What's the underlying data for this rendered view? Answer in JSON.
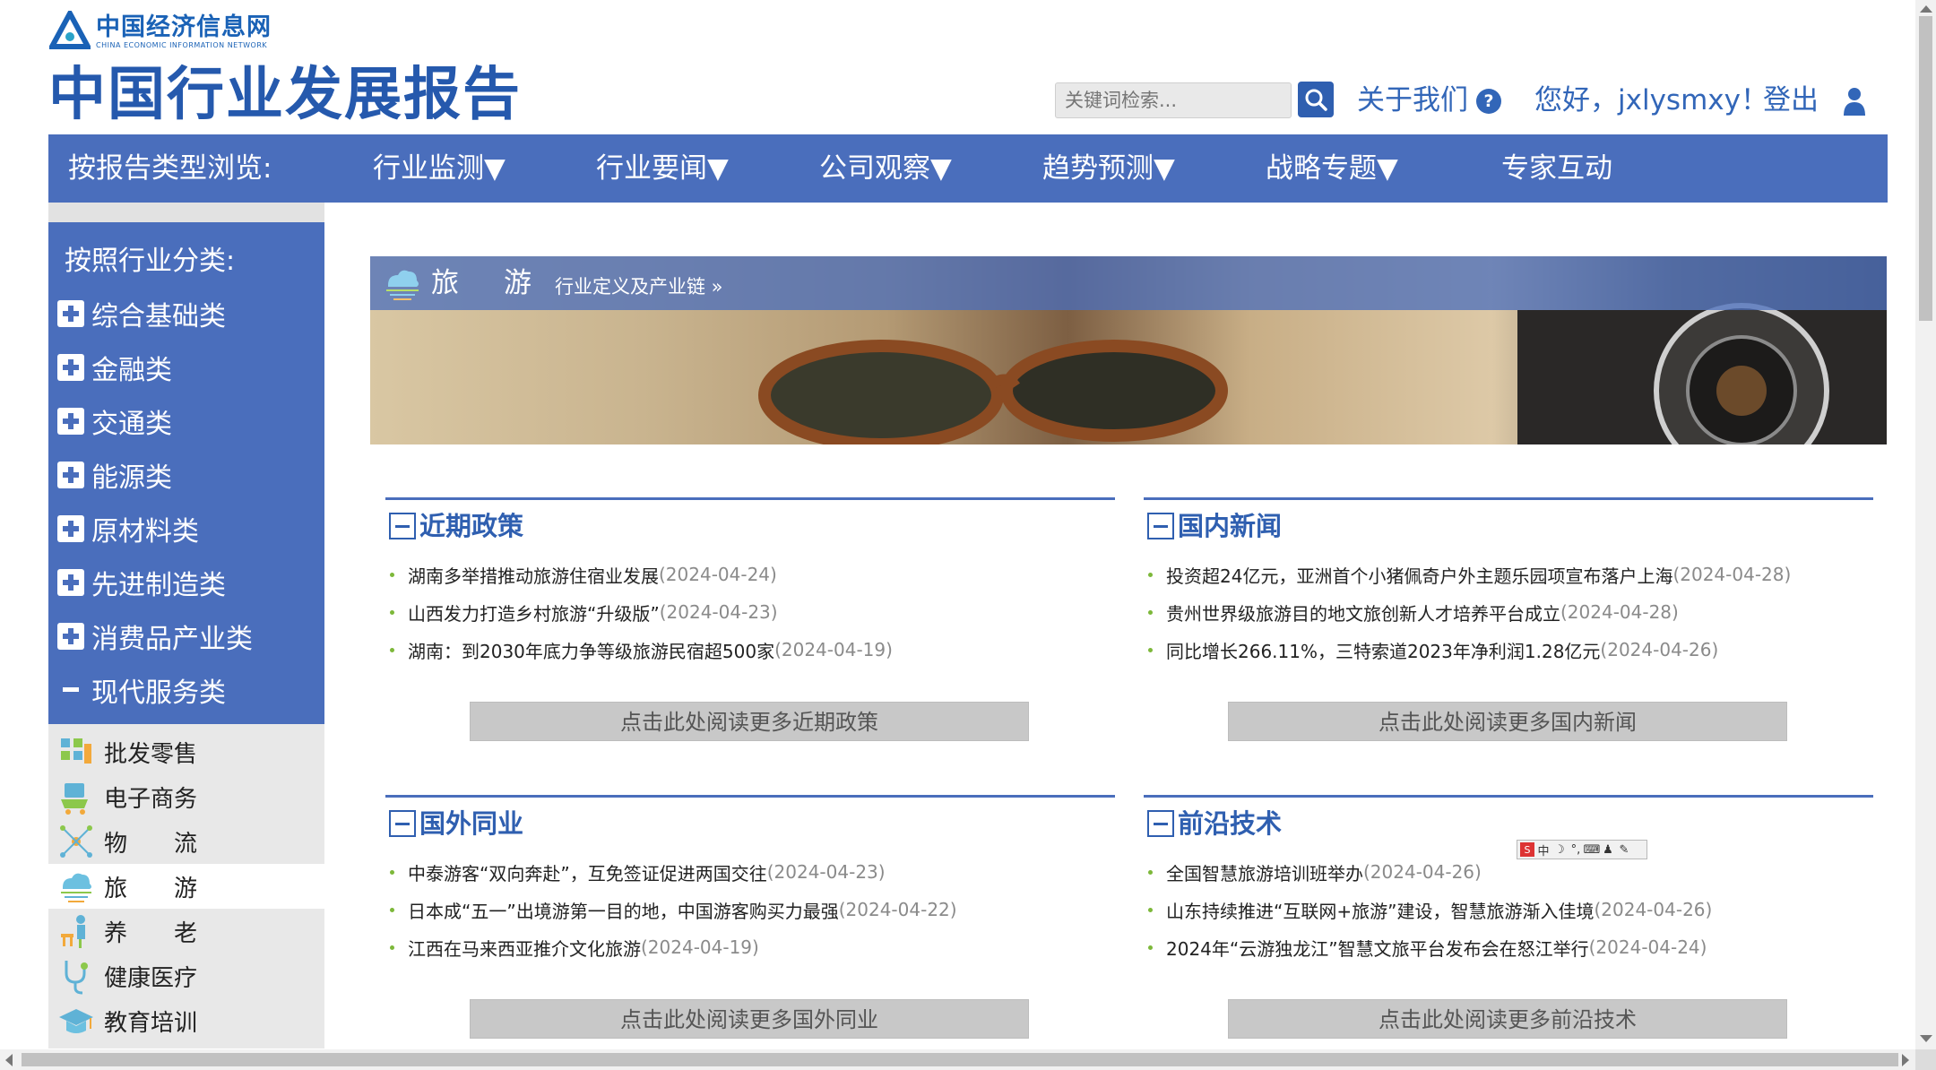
{
  "colors": {
    "brand_blue": "#4a6ebc",
    "title_blue": "#2559ad",
    "bullet_green": "#7db83a",
    "date_gray": "#8a8a8a"
  },
  "header": {
    "logo_cn": "中国经济信息网",
    "logo_en": "CHINA ECONOMIC INFORMATION NETWORK",
    "site_title": "中国行业发展报告",
    "search_placeholder": "关键词检索...",
    "about": "关于我们",
    "help_icon": "?",
    "greeting": "您好，jxlysmxy！",
    "logout": "登出"
  },
  "nav": {
    "browse_label": "按报告类型浏览:",
    "items": [
      "行业监测▼",
      "行业要闻▼",
      "公司观察▼",
      "趋势预测▼",
      "战略专题▼",
      "专家互动"
    ]
  },
  "sidebar": {
    "title": "按照行业分类:",
    "categories": [
      "综合基础类",
      "金融类",
      "交通类",
      "能源类",
      "原材料类",
      "先进制造类",
      "消费品产业类",
      "现代服务类"
    ],
    "expanded_index": 7,
    "subitems": [
      "批发零售",
      "电子商务",
      "物　　流",
      "旅　　游",
      "养　　老",
      "健康医疗",
      "教育培训"
    ],
    "active_sub_index": 3
  },
  "banner": {
    "title": "旅游",
    "subtitle": "行业定义及产业链 »"
  },
  "sections": [
    {
      "title": "近期政策",
      "items": [
        {
          "text": "湖南多举措推动旅游住宿业发展",
          "date": "(2024-04-24)"
        },
        {
          "text": "山西发力打造乡村旅游“升级版”",
          "date": "(2024-04-23)"
        },
        {
          "text": "湖南：到2030年底力争等级旅游民宿超500家",
          "date": "(2024-04-19)"
        }
      ],
      "more": "点击此处阅读更多近期政策"
    },
    {
      "title": "国内新闻",
      "items": [
        {
          "text": "投资超24亿元，亚洲首个小猪佩奇户外主题乐园项宣布落户上海",
          "date": "(2024-04-28)"
        },
        {
          "text": "贵州世界级旅游目的地文旅创新人才培养平台成立",
          "date": "(2024-04-28)"
        },
        {
          "text": "同比增长266.11%，三特索道2023年净利润1.28亿元",
          "date": "(2024-04-26)"
        }
      ],
      "more": "点击此处阅读更多国内新闻"
    },
    {
      "title": "国外同业",
      "items": [
        {
          "text": "中泰游客“双向奔赴”，互免签证促进两国交往",
          "date": "(2024-04-23)"
        },
        {
          "text": "日本成“五一”出境游第一目的地，中国游客购买力最强",
          "date": "(2024-04-22)"
        },
        {
          "text": "江西在马来西亚推介文化旅游",
          "date": "(2024-04-19)"
        }
      ],
      "more": "点击此处阅读更多国外同业"
    },
    {
      "title": "前沿技术",
      "items": [
        {
          "text": "全国智慧旅游培训班举办",
          "date": "(2024-04-26)"
        },
        {
          "text": "山东持续推进“互联网+旅游”建设，智慧旅游渐入佳境",
          "date": "(2024-04-26)"
        },
        {
          "text": "2024年“云游独龙江”智慧文旅平台发布会在怒江举行",
          "date": "(2024-04-24)"
        }
      ],
      "more": "点击此处阅读更多前沿技术"
    }
  ],
  "ime_toolbar": {
    "label": "中"
  }
}
